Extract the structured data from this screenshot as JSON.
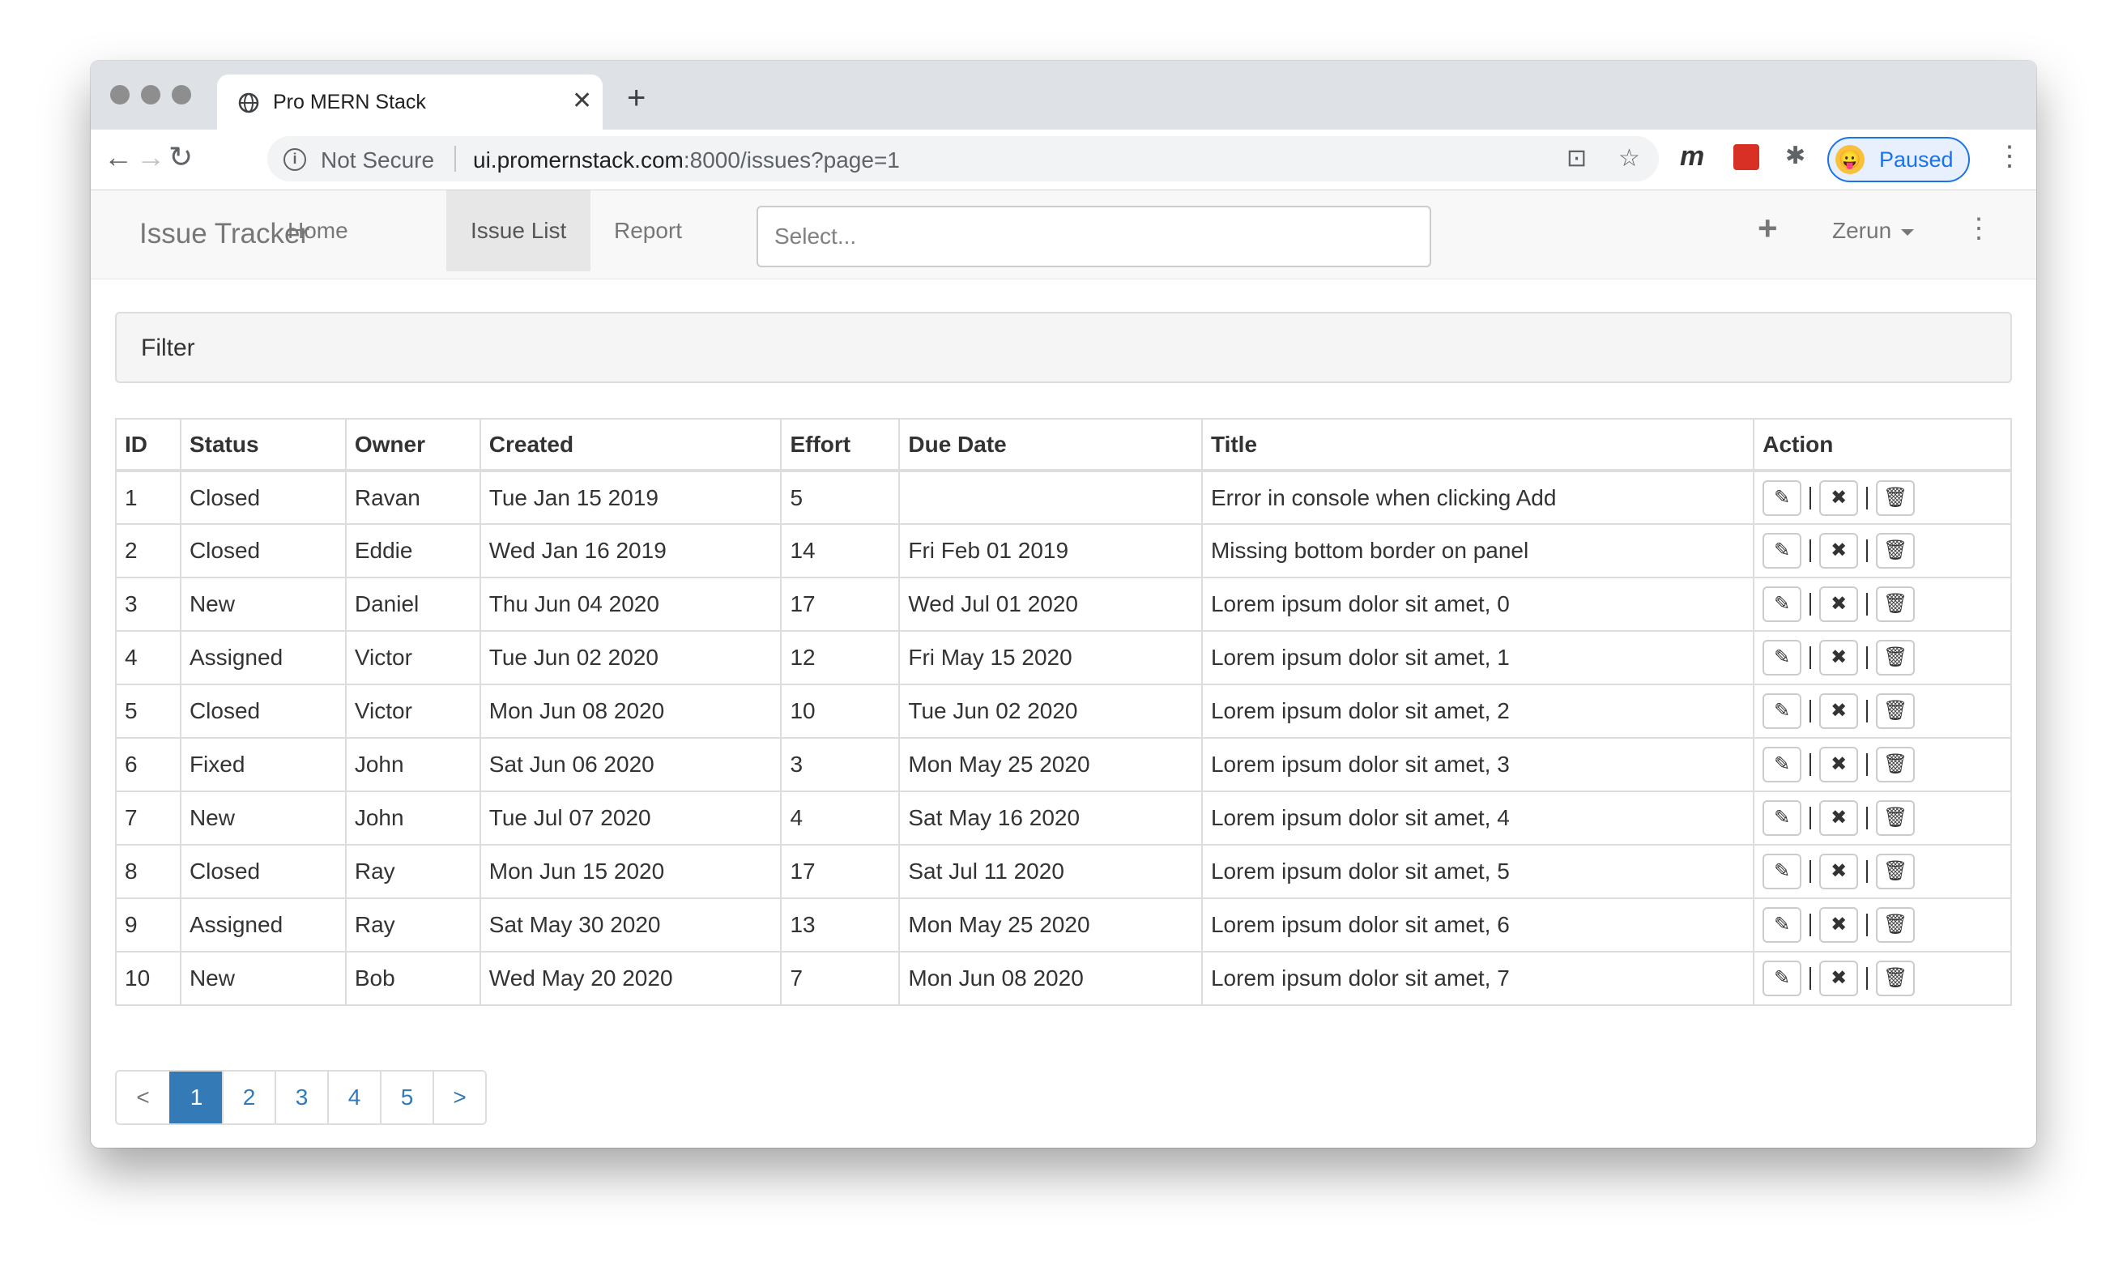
{
  "browser": {
    "tab_title": "Pro MERN Stack",
    "tab_close": "✕",
    "new_tab": "+",
    "back": "←",
    "forward": "→",
    "reload": "↻",
    "info": "i",
    "security": "Not Secure",
    "url_host": "ui.promernstack.com",
    "url_rest": ":8000/issues?page=1",
    "translate_icon": "⊡",
    "star": "☆",
    "ext_m": "m",
    "ext_puzzle": "✱",
    "paused_label": "Paused",
    "paused_avatar": "😛",
    "menu": "⋮"
  },
  "navbar": {
    "brand": "Issue Tracker",
    "links": [
      "Home",
      "Issue List",
      "Report"
    ],
    "active_link": "Issue List",
    "search_placeholder": "Select...",
    "add": "+",
    "user": "Zerun",
    "more": "⋮"
  },
  "filter": {
    "title": "Filter"
  },
  "table": {
    "headers": [
      "ID",
      "Status",
      "Owner",
      "Created",
      "Effort",
      "Due Date",
      "Title",
      "Action"
    ],
    "rows": [
      [
        "1",
        "Closed",
        "Ravan",
        "Tue Jan 15 2019",
        "5",
        "",
        "Error in console when clicking Add"
      ],
      [
        "2",
        "Closed",
        "Eddie",
        "Wed Jan 16 2019",
        "14",
        "Fri Feb 01 2019",
        "Missing bottom border on panel"
      ],
      [
        "3",
        "New",
        "Daniel",
        "Thu Jun 04 2020",
        "17",
        "Wed Jul 01 2020",
        "Lorem ipsum dolor sit amet, 0"
      ],
      [
        "4",
        "Assigned",
        "Victor",
        "Tue Jun 02 2020",
        "12",
        "Fri May 15 2020",
        "Lorem ipsum dolor sit amet, 1"
      ],
      [
        "5",
        "Closed",
        "Victor",
        "Mon Jun 08 2020",
        "10",
        "Tue Jun 02 2020",
        "Lorem ipsum dolor sit amet, 2"
      ],
      [
        "6",
        "Fixed",
        "John",
        "Sat Jun 06 2020",
        "3",
        "Mon May 25 2020",
        "Lorem ipsum dolor sit amet, 3"
      ],
      [
        "7",
        "New",
        "John",
        "Tue Jul 07 2020",
        "4",
        "Sat May 16 2020",
        "Lorem ipsum dolor sit amet, 4"
      ],
      [
        "8",
        "Closed",
        "Ray",
        "Mon Jun 15 2020",
        "17",
        "Sat Jul 11 2020",
        "Lorem ipsum dolor sit amet, 5"
      ],
      [
        "9",
        "Assigned",
        "Ray",
        "Sat May 30 2020",
        "13",
        "Mon May 25 2020",
        "Lorem ipsum dolor sit amet, 6"
      ],
      [
        "10",
        "New",
        "Bob",
        "Wed May 20 2020",
        "7",
        "Mon Jun 08 2020",
        "Lorem ipsum dolor sit amet, 7"
      ]
    ],
    "action_icons": {
      "edit": "✎",
      "close": "✖",
      "delete": "🗑"
    }
  },
  "pagination": {
    "prev": "<",
    "pages": [
      "1",
      "2",
      "3",
      "4",
      "5"
    ],
    "current": "1",
    "next": ">"
  }
}
